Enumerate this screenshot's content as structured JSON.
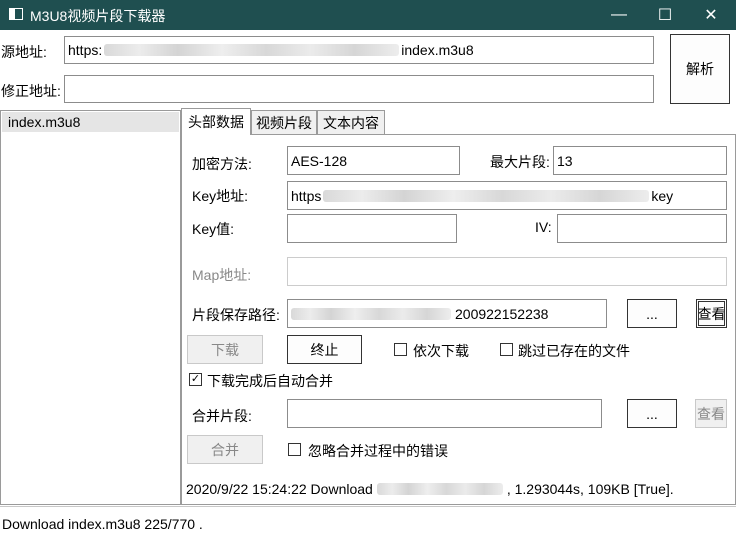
{
  "window": {
    "title": "M3U8视频片段下载器",
    "controls": {
      "minimize": "—",
      "maximize": "☐",
      "close": "✕"
    }
  },
  "source": {
    "label": "源地址:",
    "value_prefix": "https:",
    "value_suffix": "index.m3u8"
  },
  "fix": {
    "label": "修正地址:",
    "value": ""
  },
  "parse_button": "解析",
  "file_list": [
    "index.m3u8"
  ],
  "tabs": [
    {
      "label": "头部数据",
      "active": true
    },
    {
      "label": "视频片段",
      "active": false
    },
    {
      "label": "文本内容",
      "active": false
    }
  ],
  "header": {
    "encrypt_label": "加密方法:",
    "encrypt_value": "AES-128",
    "max_seg_label": "最大片段:",
    "max_seg_value": "13",
    "key_url_label": "Key地址:",
    "key_url_prefix": "https",
    "key_url_suffix": "key",
    "key_value_label": "Key值:",
    "key_value": "",
    "iv_label": "IV:",
    "iv_value": "",
    "map_label": "Map地址:",
    "map_value": "",
    "save_path_label": "片段保存路径:",
    "save_path_suffix": "200922152238",
    "browse_label": "...",
    "view_label": "查看",
    "download_button": "下载",
    "stop_button": "终止",
    "sequential_label": "依次下载",
    "sequential_checked": false,
    "skip_existing_label": "跳过已存在的文件",
    "skip_existing_checked": false,
    "auto_merge_label": "下载完成后自动合并",
    "auto_merge_checked": true,
    "merge_label": "合并片段:",
    "merge_value": "",
    "merge_browse_label": "...",
    "merge_view_label": "查看",
    "merge_button": "合并",
    "ignore_errors_label": "忽略合并过程中的错误",
    "ignore_errors_checked": false,
    "log_prefix": "2020/9/22 15:24:22 Download",
    "log_suffix": ", 1.293044s, 109KB [True]."
  },
  "status": {
    "text": "Download index.m3u8 225/770 ."
  },
  "icons": {
    "check": "✓"
  }
}
